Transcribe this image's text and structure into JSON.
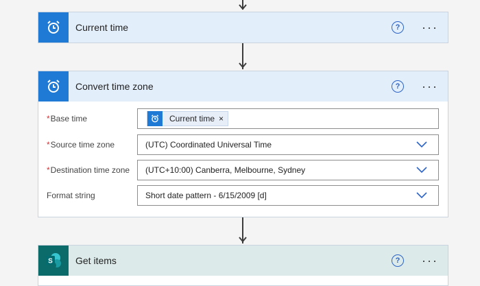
{
  "actions": [
    {
      "title": "Current time",
      "icon": "alarm-clock-icon",
      "help": "?",
      "more": "···"
    },
    {
      "title": "Convert time zone",
      "icon": "alarm-clock-icon",
      "help": "?",
      "more": "···",
      "fields": [
        {
          "label": "Base time",
          "required": true,
          "type": "token",
          "token": {
            "label": "Current time",
            "icon": "alarm-clock-icon",
            "remove": "×"
          }
        },
        {
          "label": "Source time zone",
          "required": true,
          "type": "dropdown",
          "value": "(UTC) Coordinated Universal Time"
        },
        {
          "label": "Destination time zone",
          "required": true,
          "type": "dropdown",
          "value": "(UTC+10:00) Canberra, Melbourne, Sydney"
        },
        {
          "label": "Format string",
          "required": false,
          "type": "dropdown",
          "value": "Short date pattern - 6/15/2009 [d]"
        }
      ]
    },
    {
      "title": "Get items",
      "icon": "sharepoint-icon",
      "help": "?",
      "more": "···"
    }
  ],
  "colors": {
    "flow_blue": "#1f7ad6",
    "sharepoint_teal": "#0b6a6a",
    "required_red": "#d13438",
    "chevron_blue": "#2b63c7"
  }
}
